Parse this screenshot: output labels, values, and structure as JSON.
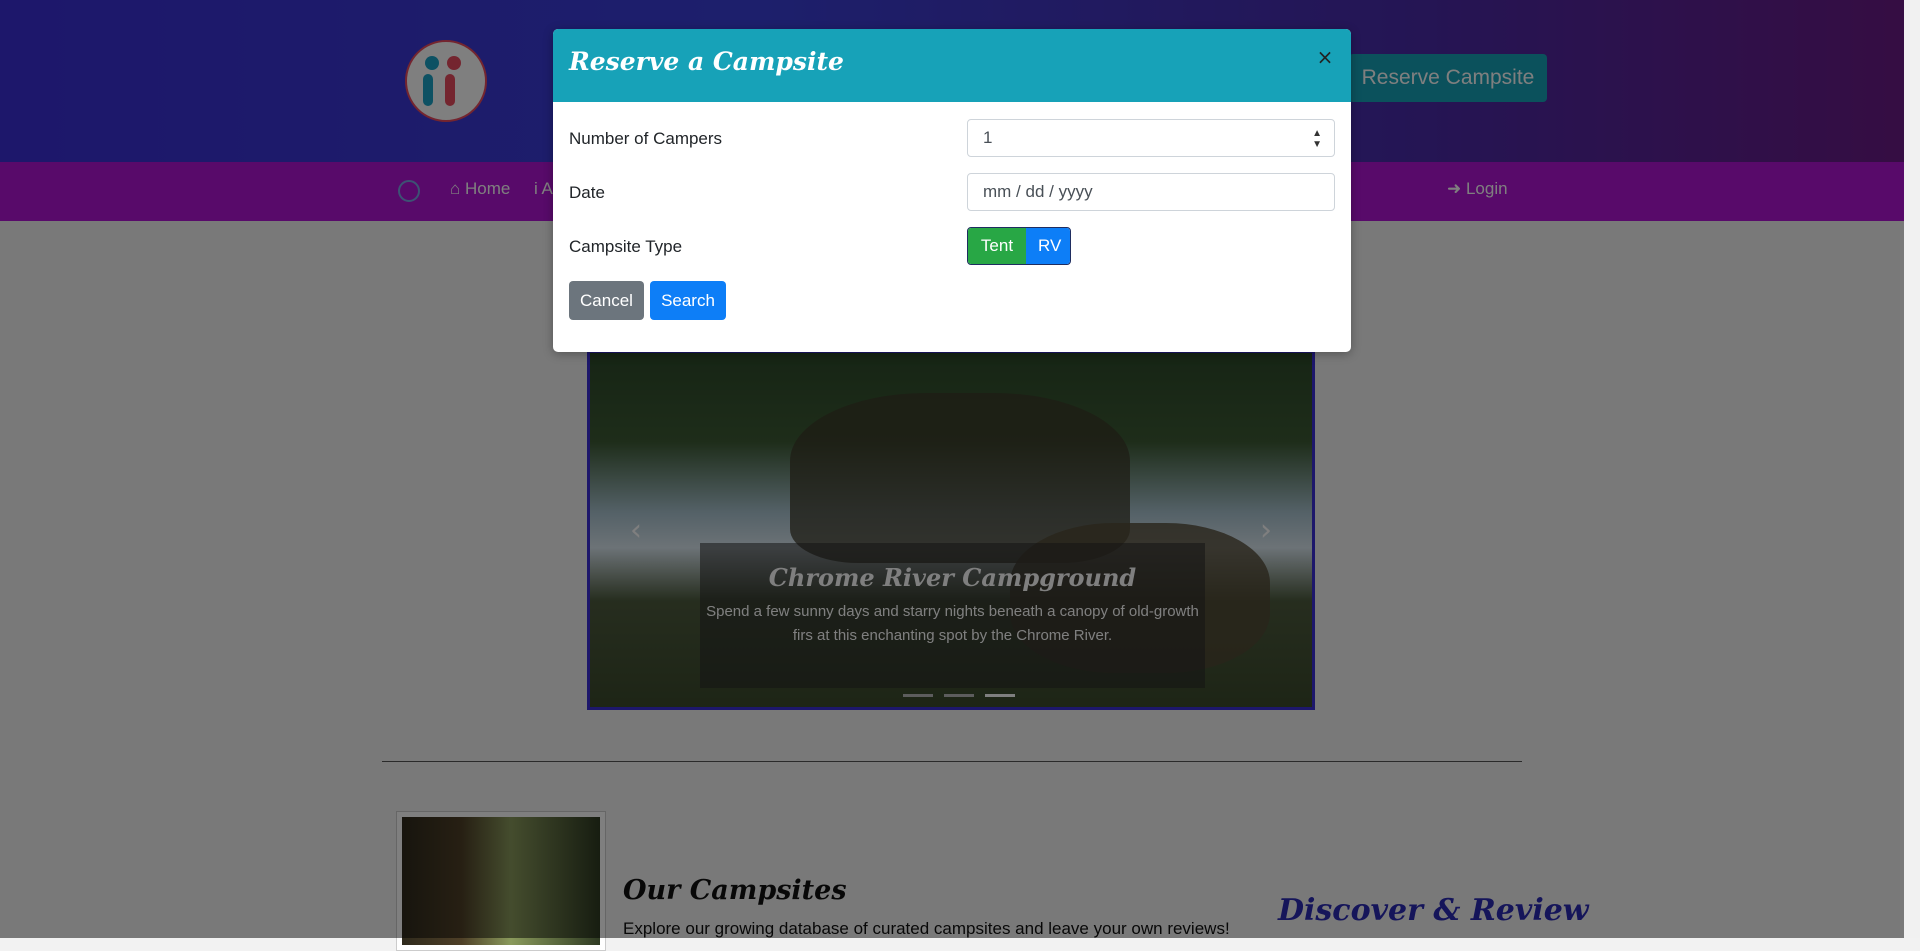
{
  "header": {
    "reserve_button": "Reserve Campsite"
  },
  "nav": {
    "home": "⌂ Home",
    "about_partial": "i A",
    "login": "➜ Login"
  },
  "carousel": {
    "title": "Chrome River Campground",
    "text": "Spend a few sunny days and starry nights beneath a canopy of old-growth firs at this enchanting spot by the Chrome River.",
    "slide_count": 3,
    "active_slide": 3
  },
  "sections": {
    "campsites_title": "Our Campsites",
    "campsites_text": "Explore our growing database of curated campsites and leave your own reviews!",
    "discover_title": "Discover & Review"
  },
  "modal": {
    "title": "Reserve a Campsite",
    "close_glyph": "×",
    "campers_label": "Number of Campers",
    "campers_value": "1",
    "date_label": "Date",
    "date_placeholder": "mm / dd / yyyy",
    "type_label": "Campsite Type",
    "type_options": [
      "Tent",
      "RV"
    ],
    "cancel_label": "Cancel",
    "search_label": "Search"
  },
  "colors": {
    "modal_header": "#17a2b8",
    "tent": "#28a745",
    "rv": "#0d7ef7",
    "cancel": "#6c757d",
    "search": "#0d7ef7",
    "navbar": "#b014d4"
  }
}
